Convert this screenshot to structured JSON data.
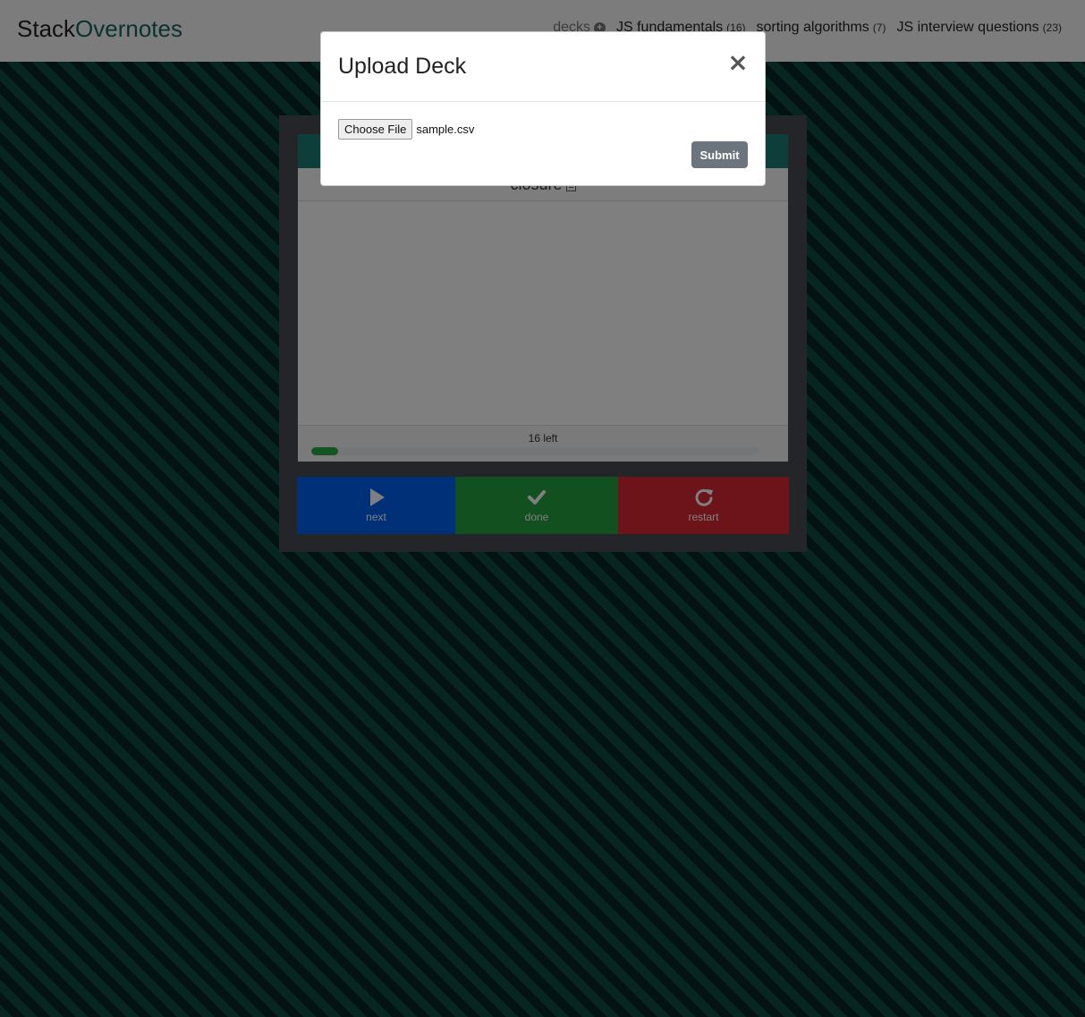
{
  "navbar": {
    "brand_part1": "Stack",
    "brand_part2": "Overnotes",
    "decks_label": "decks",
    "decks": [
      {
        "name": "JS fundamentals",
        "count": "(16)"
      },
      {
        "name": "sorting algorithms",
        "count": "(7)"
      },
      {
        "name": "JS interview questions",
        "count": "(23)"
      }
    ]
  },
  "card": {
    "title": "closure",
    "remaining_label": "16 left",
    "progress_percent": 6
  },
  "actions": {
    "next_label": "next",
    "done_label": "done",
    "restart_label": "restart"
  },
  "modal": {
    "title": "Upload Deck",
    "close_symbol": "×",
    "choose_file_label": "Choose File",
    "file_name": "sample.csv",
    "submit_label": "Submit"
  },
  "colors": {
    "brand_accent": "#16675d",
    "next": "#0062f0",
    "done": "#25a03f",
    "restart": "#d92833",
    "progress": "#28a745"
  }
}
